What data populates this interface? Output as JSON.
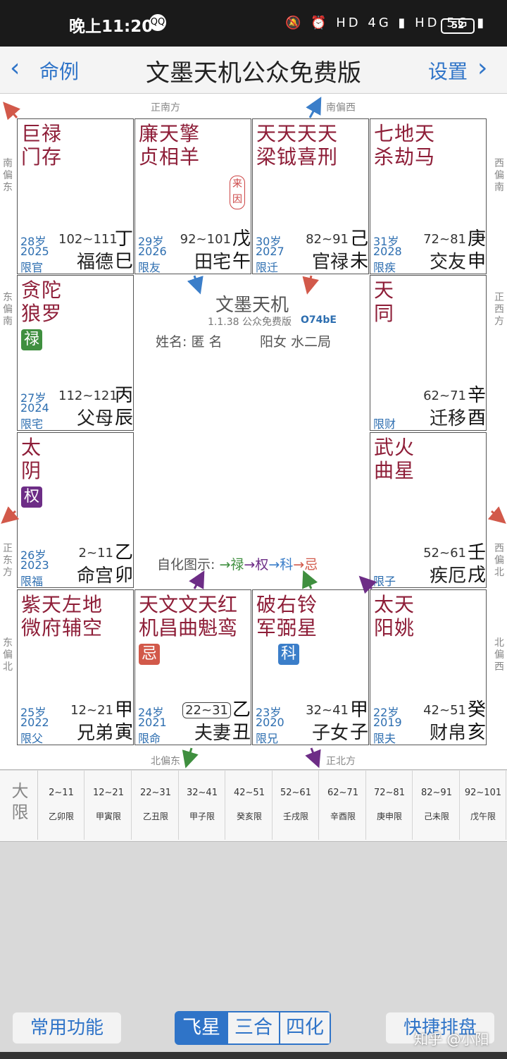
{
  "status": {
    "time": "晚上11:20",
    "qq": "QQ",
    "icons": "🔕 ⏰ HD 4G ▮ HD 5G ▮",
    "battery": "52"
  },
  "nav": {
    "back_label": "命例",
    "title": "文墨天机公众免费版",
    "settings_label": "设置"
  },
  "directions": {
    "top_left": "正南方",
    "top_right": "南偏西",
    "bottom_left": "北偏东",
    "bottom_right": "正北方",
    "left_top": "南偏东",
    "left_mid1": "东偏南",
    "left_mid2": "正东方",
    "left_bottom": "东偏北",
    "right_top": "西偏南",
    "right_mid1": "正西方",
    "right_mid2": "西偏北",
    "right_bottom": "北偏西"
  },
  "palaces": [
    {
      "stars": [
        "巨禄",
        "门存"
      ],
      "age": "28岁",
      "year": "2025",
      "xian": "限官",
      "range": "102~111",
      "name": "福德",
      "gz": [
        "丁",
        "巳"
      ]
    },
    {
      "stars": [
        "廉天擎",
        "贞相羊"
      ],
      "laiyin": "来因",
      "age": "29岁",
      "year": "2026",
      "xian": "限友",
      "range": "92~101",
      "name": "田宅",
      "gz": [
        "戊",
        "午"
      ]
    },
    {
      "stars": [
        "天天天天",
        "梁钺喜刑"
      ],
      "age": "30岁",
      "year": "2027",
      "xian": "限迁",
      "range": "82~91",
      "name": "官禄",
      "gz": [
        "己",
        "未"
      ]
    },
    {
      "stars": [
        "七地天",
        "杀劫马"
      ],
      "age": "31岁",
      "year": "2028",
      "xian": "限疾",
      "range": "72~81",
      "name": "交友",
      "gz": [
        "庚",
        "申"
      ]
    },
    {
      "stars": [
        "贪陀",
        "狼罗"
      ],
      "hua": "禄",
      "age": "27岁",
      "year": "2024",
      "xian": "限宅",
      "range": "112~121",
      "name": "父母",
      "gz": [
        "丙",
        "辰"
      ]
    },
    {
      "stars": [
        "天",
        "同"
      ],
      "xian": "限财",
      "range": "62~71",
      "name": "迁移",
      "gz": [
        "辛",
        "酉"
      ]
    },
    {
      "stars": [
        "太",
        "阴"
      ],
      "hua": "权",
      "age": "26岁",
      "year": "2023",
      "xian": "限福",
      "range": "2~11",
      "name": "命宫",
      "gz": [
        "乙",
        "卯"
      ]
    },
    {
      "stars": [
        "武火",
        "曲星"
      ],
      "xian": "限子",
      "range": "52~61",
      "name": "疾厄",
      "gz": [
        "壬",
        "戌"
      ]
    },
    {
      "stars": [
        "紫天左地",
        "微府辅空"
      ],
      "age": "25岁",
      "year": "2022",
      "xian": "限父",
      "range": "12~21",
      "name": "兄弟",
      "gz": [
        "甲",
        "寅"
      ]
    },
    {
      "stars": [
        "天文文天红",
        "机昌曲魁鸾"
      ],
      "hua": "忌",
      "age": "24岁",
      "year": "2021",
      "xian": "限命",
      "range": "22~31",
      "name": "夫妻",
      "gz": [
        "乙",
        "丑"
      ]
    },
    {
      "stars": [
        "破右铃",
        "军弼星"
      ],
      "hua": "科",
      "age": "23岁",
      "year": "2020",
      "xian": "限兄",
      "range": "32~41",
      "name": "子女",
      "gz": [
        "甲",
        "子"
      ]
    },
    {
      "stars": [
        "太天",
        "阳姚"
      ],
      "age": "22岁",
      "year": "2019",
      "xian": "限夫",
      "range": "42~51",
      "name": "财帛",
      "gz": [
        "癸",
        "亥"
      ]
    }
  ],
  "center": {
    "title": "文墨天机",
    "version": "1.1.38 公众免费版",
    "code": "O74bE",
    "name": "姓名: 匿 名",
    "bureau": "阳女 水二局",
    "legend_prefix": "自化图示:",
    "legend": [
      "禄",
      "权",
      "科",
      "忌"
    ]
  },
  "daxian": {
    "label": [
      "大",
      "限"
    ],
    "cells": [
      {
        "r": "2~11",
        "n": "乙卯限"
      },
      {
        "r": "12~21",
        "n": "甲寅限"
      },
      {
        "r": "22~31",
        "n": "乙丑限"
      },
      {
        "r": "32~41",
        "n": "甲子限"
      },
      {
        "r": "42~51",
        "n": "癸亥限"
      },
      {
        "r": "52~61",
        "n": "壬戌限"
      },
      {
        "r": "62~71",
        "n": "辛酉限"
      },
      {
        "r": "72~81",
        "n": "庚申限"
      },
      {
        "r": "82~91",
        "n": "己未限"
      },
      {
        "r": "92~101",
        "n": "戊午限"
      }
    ]
  },
  "toolbar": {
    "common": "常用功能",
    "seg": [
      "飞星",
      "三合",
      "四化"
    ],
    "quick": "快捷排盘"
  },
  "watermark": "知乎 @小阳",
  "colors": {
    "lu": "#3f8f3f",
    "quan": "#6d2d86",
    "ke": "#3b7ec9",
    "ji": "#d2594a",
    "star": "#8e1e38",
    "accent": "#2f74c8"
  }
}
